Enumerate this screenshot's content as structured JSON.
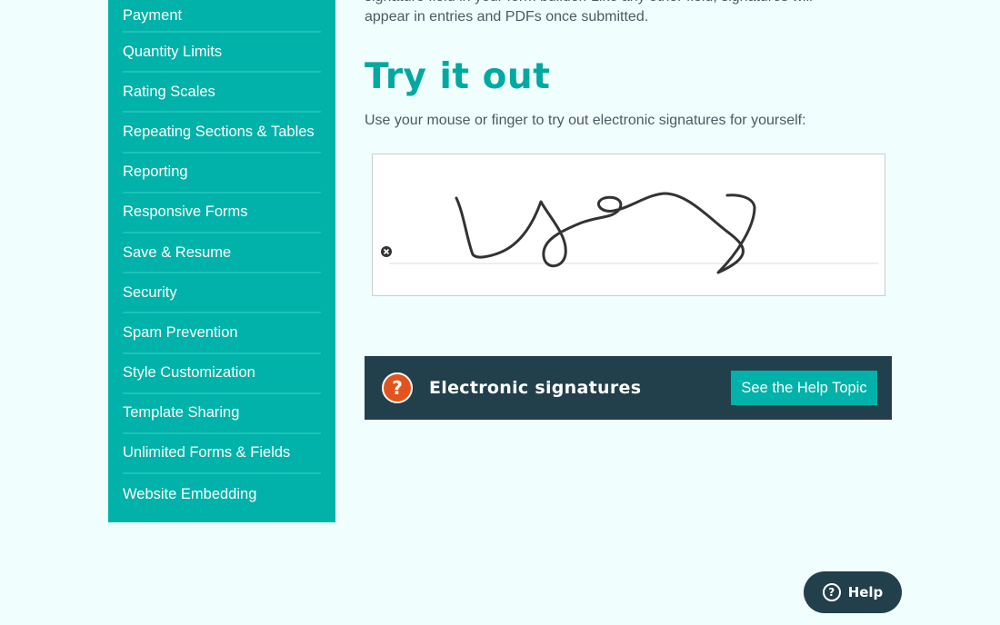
{
  "sidebar": {
    "items": [
      "Payment",
      "Quantity Limits",
      "Rating Scales",
      "Repeating Sections & Tables",
      "Reporting",
      "Responsive Forms",
      "Save & Resume",
      "Security",
      "Spam Prevention",
      "Style Customization",
      "Template Sharing",
      "Unlimited Forms & Fields",
      "Website Embedding"
    ]
  },
  "main": {
    "intro_line1": "signature field in your form builder. Like any other field, signatures will",
    "intro_line2": "appear in entries and PDFs once submitted.",
    "heading": "Try it out",
    "instructions": "Use your mouse or finger to try out electronic signatures for yourself:",
    "help_bar": {
      "icon": "question-icon",
      "icon_glyph": "?",
      "title": "Electronic signatures",
      "button_label": "See the Help Topic"
    }
  },
  "float_help": {
    "icon_glyph": "?",
    "label": "Help"
  },
  "colors": {
    "sidebar": "#00b2a9",
    "accent": "#00a9a0",
    "dark": "#223f4c",
    "orange": "#e2541e",
    "background": "#f0fefe"
  }
}
